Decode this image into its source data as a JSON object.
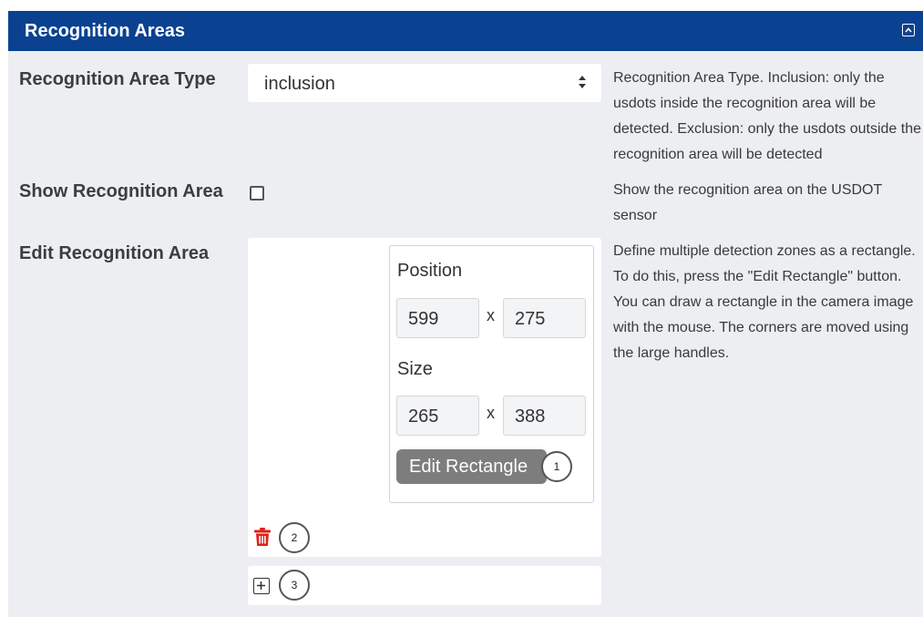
{
  "panel": {
    "title": "Recognition Areas",
    "collapse_icon": "collapse-up-icon",
    "accent_color": "#0a4191"
  },
  "type_row": {
    "label": "Recognition Area Type",
    "selected": "inclusion",
    "help": "Recognition Area Type. Inclusion: only the usdots inside the recognition area will be detected. Exclusion: only the usdots outside the recognition area will be detected"
  },
  "show_row": {
    "label": "Show Recognition Area",
    "checked": false,
    "help": "Show the recognition area on the USDOT sensor"
  },
  "edit_row": {
    "label": "Edit Recognition Area",
    "help": "Define multiple detection zones as a rectangle. To do this, press the \"Edit Rectangle\" button. You can draw a rectangle in the camera image with the mouse. The corners are moved using the large handles.",
    "position_label": "Position",
    "position_x": "599",
    "position_y": "275",
    "size_label": "Size",
    "size_w": "265",
    "size_h": "388",
    "separator": "x",
    "edit_button": "Edit Rectangle",
    "delete_icon": "trash-icon",
    "add_icon": "plus-square-icon",
    "delete_color": "#e0201b"
  },
  "callouts": [
    "1",
    "2",
    "3"
  ]
}
